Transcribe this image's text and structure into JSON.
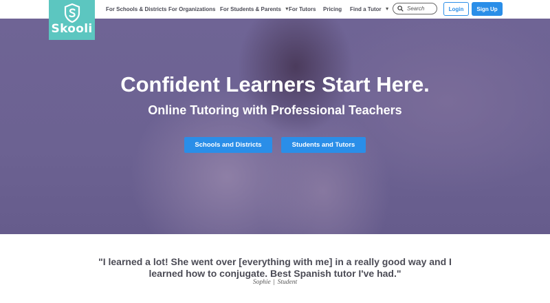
{
  "brand": {
    "name": "Skooli",
    "logo_icon": "shield-s-icon",
    "color": "#5cc6c0"
  },
  "nav": {
    "items": [
      {
        "label": "For Schools & Districts",
        "has_dropdown": false
      },
      {
        "label": "For Organizations",
        "has_dropdown": false
      },
      {
        "label": "For Students & Parents",
        "has_dropdown": true
      },
      {
        "label": "For Tutors",
        "has_dropdown": false
      },
      {
        "label": "Pricing",
        "has_dropdown": false
      },
      {
        "label": "Find a Tutor",
        "has_dropdown": true
      }
    ],
    "search_placeholder": "Search",
    "login_label": "Login",
    "signup_label": "Sign Up"
  },
  "hero": {
    "title": "Confident Learners Start Here.",
    "subtitle": "Online Tutoring with Professional Teachers",
    "buttons": [
      {
        "label": "Schools and Districts"
      },
      {
        "label": "Students and Tutors"
      }
    ]
  },
  "testimonial": {
    "quote": "\"I learned a lot! She went over [everything with me] in a really good way and I learned how to conjugate. Best Spanish tutor I've had.\"",
    "author": "Sophie",
    "separator": "|",
    "role": "Student"
  },
  "colors": {
    "accent": "#2a8ee8",
    "hero_overlay": "#6c6292",
    "brand": "#5cc6c0"
  }
}
